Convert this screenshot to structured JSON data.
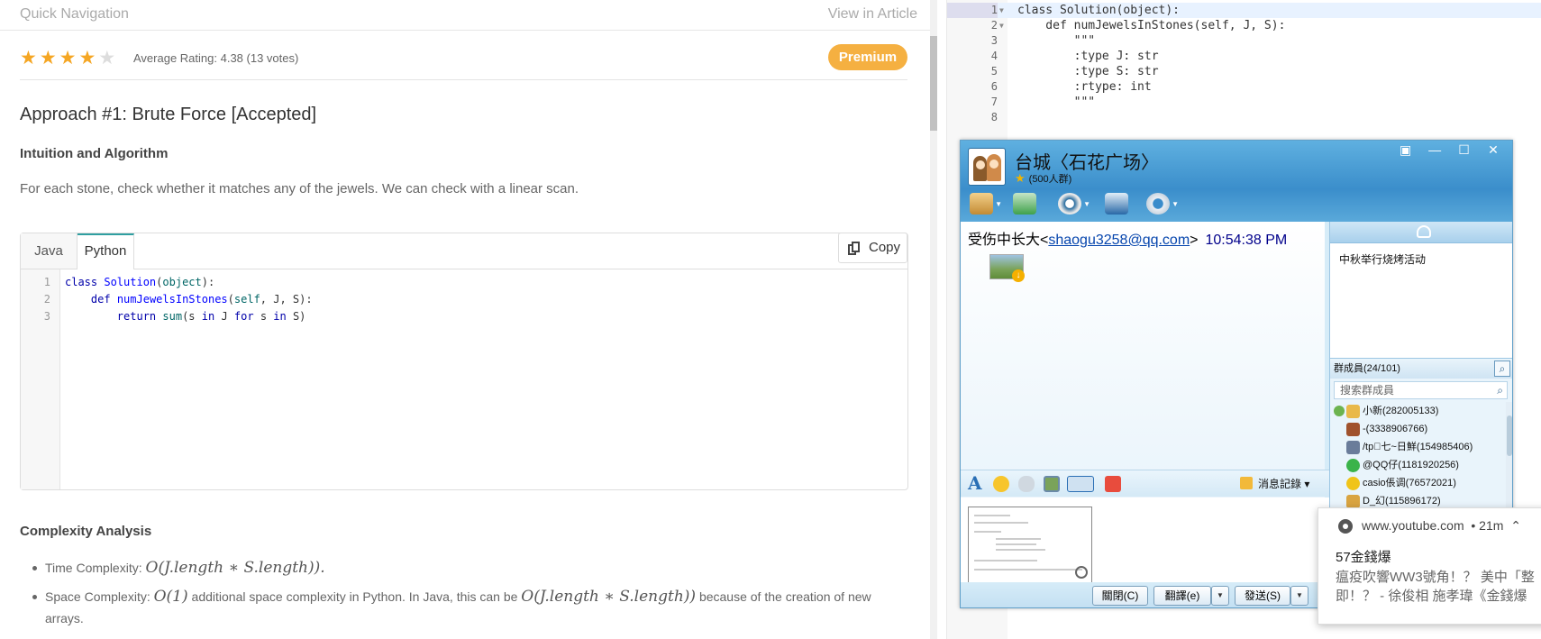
{
  "article": {
    "quick_nav": "Quick Navigation",
    "view_in_article": "View in Article",
    "stars": "★★★★",
    "half_star": "★",
    "rating_text": "Average Rating: 4.38 (13 votes)",
    "premium": "Premium",
    "approach_title": "Approach #1: Brute Force [Accepted]",
    "intuition_title": "Intuition and Algorithm",
    "intuition_text": "For each stone, check whether it matches any of the jewels. We can check with a linear scan.",
    "tabs": [
      "Java",
      "Python"
    ],
    "active_tab": "Python",
    "copy_label": "Copy",
    "code_line_numbers": [
      "1",
      "2",
      "3"
    ],
    "complexity_title": "Complexity Analysis",
    "time_label": "Time Complexity: ",
    "time_math": "O(J.length ∗ S.length)).",
    "space_label": "Space Complexity: ",
    "space_math1": "O(1)",
    "space_mid": " additional space complexity in Python. In Java, this can be ",
    "space_math2": "O(J.length ∗ S.length))",
    "space_end": " because of the creation of new arrays."
  },
  "editor": {
    "lines": [
      {
        "num": "1",
        "fold": "▼",
        "text": "class Solution(object):"
      },
      {
        "num": "2",
        "fold": "▼",
        "text": "    def numJewelsInStones(self, J, S):"
      },
      {
        "num": "3",
        "fold": "",
        "text": "        \"\"\""
      },
      {
        "num": "4",
        "fold": "",
        "text": "        :type J: str"
      },
      {
        "num": "5",
        "fold": "",
        "text": "        :type S: str"
      },
      {
        "num": "6",
        "fold": "",
        "text": "        :rtype: int"
      },
      {
        "num": "7",
        "fold": "",
        "text": "        \"\"\""
      },
      {
        "num": "8",
        "fold": "",
        "text": ""
      }
    ]
  },
  "qq": {
    "title": "台城〈石花广场〉",
    "subtitle": "(500人群)",
    "sender_name": "受伤中长大",
    "sender_email": "shaogu3258@qq.com",
    "message_time": "10:54:38 PM",
    "announcement": "中秋举行烧烤活动",
    "members_header": "群成員(24/101)",
    "member_search_placeholder": "搜索群成員",
    "members": [
      "小新(282005133)",
      "-(3338906766)",
      "/tp゙七~日鮮(154985406)",
      "@QQ仔(1181920256)",
      "casio倀调(76572021)",
      "D_幻(115896172)"
    ],
    "history_label": "消息記錄",
    "buttons": {
      "close": "關閉(C)",
      "translate": "翻譯(e)",
      "send": "發送(S)"
    }
  },
  "notification": {
    "site": "www.youtube.com",
    "time": "• 21m",
    "title": "57金錢爆",
    "body_line1": "瘟疫吹響WW3號角！？ 美中「整",
    "body_line2": "即！？ - 徐俊相 施孝瑋《金錢爆"
  },
  "colors": {
    "premium": "#f5b041",
    "star": "#f5a623",
    "tab_accent": "#2f9fa1",
    "qq_header": "#3b8ecb"
  }
}
